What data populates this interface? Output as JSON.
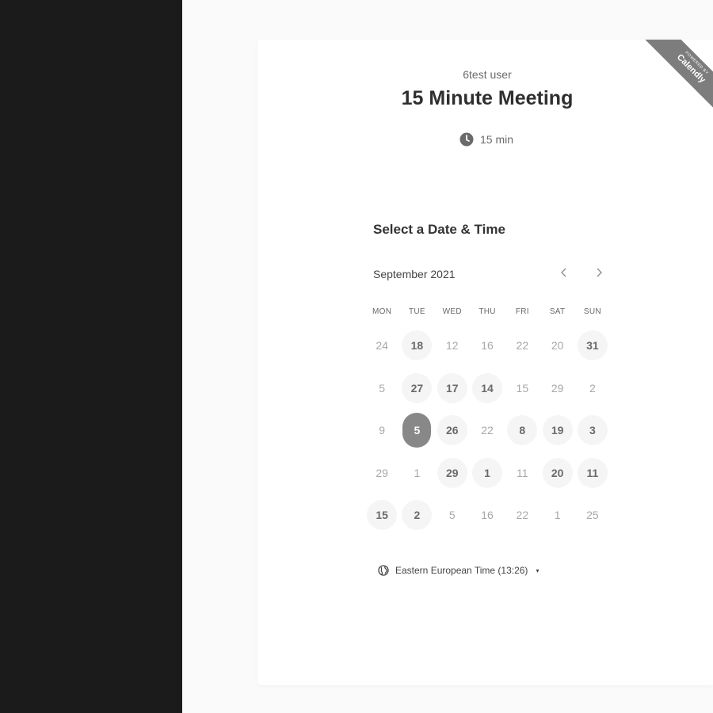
{
  "card": {
    "host_name": "6test user",
    "event_title": "15 Minute Meeting",
    "duration": "15 min",
    "ribbon": {
      "small_text": "POWERED BY",
      "brand": "Calendly"
    }
  },
  "scheduler": {
    "section_title": "Select a Date & Time",
    "month_label": "September 2021",
    "prev_icon": "chevron-left-icon",
    "next_icon": "chevron-right-icon",
    "weekdays": [
      "MON",
      "TUE",
      "WED",
      "THU",
      "FRI",
      "SAT",
      "SUN"
    ],
    "days": [
      {
        "label": "24",
        "state": "disabled"
      },
      {
        "label": "18",
        "state": "available"
      },
      {
        "label": "12",
        "state": "disabled"
      },
      {
        "label": "16",
        "state": "disabled"
      },
      {
        "label": "22",
        "state": "disabled"
      },
      {
        "label": "20",
        "state": "disabled"
      },
      {
        "label": "31",
        "state": "available"
      },
      {
        "label": "5",
        "state": "disabled"
      },
      {
        "label": "27",
        "state": "available"
      },
      {
        "label": "17",
        "state": "available"
      },
      {
        "label": "14",
        "state": "available"
      },
      {
        "label": "15",
        "state": "disabled"
      },
      {
        "label": "29",
        "state": "disabled"
      },
      {
        "label": "2",
        "state": "disabled"
      },
      {
        "label": "9",
        "state": "disabled"
      },
      {
        "label": "5",
        "state": "selected"
      },
      {
        "label": "26",
        "state": "available"
      },
      {
        "label": "22",
        "state": "disabled"
      },
      {
        "label": "8",
        "state": "available"
      },
      {
        "label": "19",
        "state": "available"
      },
      {
        "label": "3",
        "state": "available"
      },
      {
        "label": "29",
        "state": "disabled"
      },
      {
        "label": "1",
        "state": "disabled"
      },
      {
        "label": "29",
        "state": "available"
      },
      {
        "label": "1",
        "state": "available"
      },
      {
        "label": "11",
        "state": "disabled"
      },
      {
        "label": "20",
        "state": "available"
      },
      {
        "label": "11",
        "state": "available"
      },
      {
        "label": "15",
        "state": "available"
      },
      {
        "label": "2",
        "state": "available"
      },
      {
        "label": "5",
        "state": "disabled"
      },
      {
        "label": "16",
        "state": "disabled"
      },
      {
        "label": "22",
        "state": "disabled"
      },
      {
        "label": "1",
        "state": "disabled"
      },
      {
        "label": "25",
        "state": "disabled"
      }
    ],
    "timezone": "Eastern European Time (13:26)",
    "timezone_icon": "globe-icon",
    "caret": "▾"
  },
  "colors": {
    "left_panel": "#1b1b1b",
    "selected_day": "#888888",
    "available_day_bg": "#f5f5f5",
    "ribbon": "#7d7d7d"
  }
}
